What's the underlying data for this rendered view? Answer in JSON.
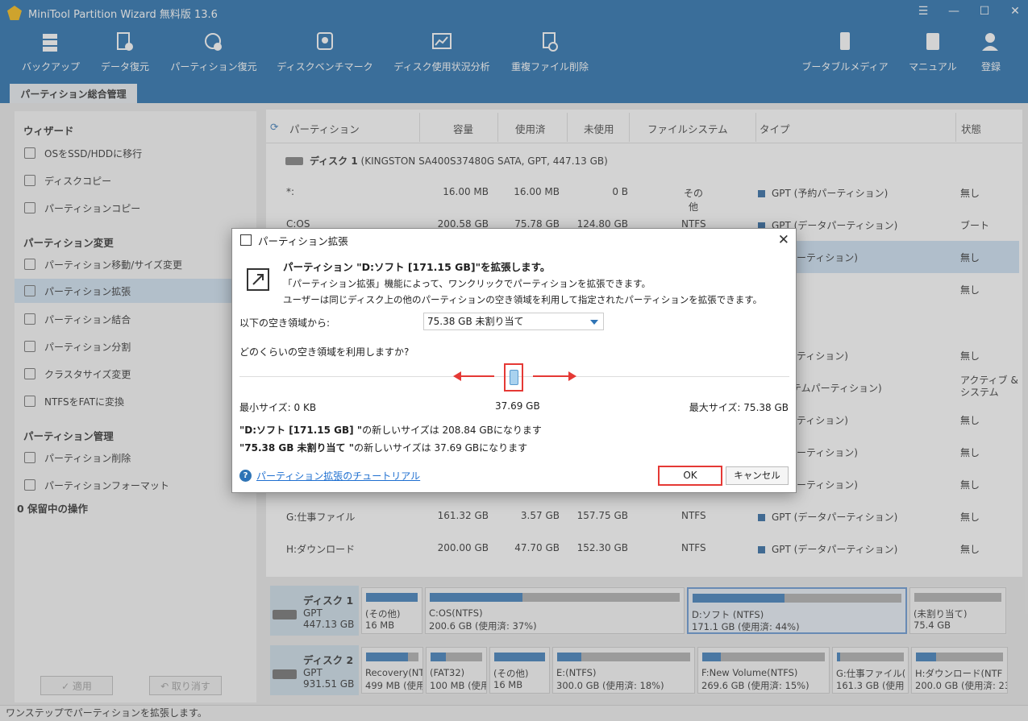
{
  "window": {
    "title": "MiniTool Partition Wizard 無料版 13.6"
  },
  "toolbar": {
    "items": [
      {
        "label": "バックアップ",
        "icon": "backup-icon"
      },
      {
        "label": "データ復元",
        "icon": "data-recovery-icon"
      },
      {
        "label": "パーティション復元",
        "icon": "partition-recovery-icon"
      },
      {
        "label": "ディスクベンチマーク",
        "icon": "disk-benchmark-icon"
      },
      {
        "label": "ディスク使用状況分析",
        "icon": "space-analyzer-icon"
      },
      {
        "label": "重複ファイル削除",
        "icon": "duplicate-file-icon"
      },
      {
        "label": "ブータブルメディア",
        "icon": "bootable-media-icon"
      },
      {
        "label": "マニュアル",
        "icon": "manual-icon"
      },
      {
        "label": "登録",
        "icon": "register-icon"
      }
    ]
  },
  "tab": {
    "label": "パーティション総合管理"
  },
  "sidebar": {
    "wizard_title": "ウィザード",
    "wizard_items": [
      "OSをSSD/HDDに移行",
      "ディスクコピー",
      "パーティションコピー"
    ],
    "change_title": "パーティション変更",
    "change_items": [
      "パーティション移動/サイズ変更",
      "パーティション拡張",
      "パーティション結合",
      "パーティション分割",
      "クラスタサイズ変更",
      "NTFSをFATに変換"
    ],
    "manage_title": "パーティション管理",
    "manage_items": [
      "パーティション削除",
      "パーティションフォーマット"
    ],
    "pending": "0 保留中の操作",
    "apply": "✓ 適用",
    "undo": "↶ 取り消す"
  },
  "table": {
    "headers": [
      "パーティション",
      "容量",
      "使用済",
      "未使用",
      "ファイルシステム",
      "タイプ",
      "状態"
    ],
    "disk1_header": "ディスク 1 (KINGSTON SA400S37480G SATA, GPT, 447.13 GB)",
    "disk1_name": "ディスク 1",
    "disk1_detail": "(KINGSTON SA400S37480G SATA, GPT, 447.13 GB)",
    "rows": [
      {
        "name": "*:",
        "cap": "16.00 MB",
        "used": "16.00 MB",
        "free": "0 B",
        "fs": "その他",
        "type": "GPT (予約パーティション)",
        "status": "無し"
      },
      {
        "name": "C:OS",
        "cap": "200.58 GB",
        "used": "75.78 GB",
        "free": "124.80 GB",
        "fs": "NTFS",
        "type": "GPT (データパーティション)",
        "status": "ブート"
      },
      {
        "name": "",
        "cap": "",
        "used": "",
        "free": "",
        "fs": "",
        "type": "データパーティション)",
        "status": "無し"
      },
      {
        "name": "",
        "cap": "",
        "used": "",
        "free": "",
        "fs": "",
        "type": "",
        "status": "無し"
      },
      {
        "name": "",
        "cap": "",
        "used": "",
        "free": "",
        "fs": "",
        "type": "復元パーティション)",
        "status": "無し"
      },
      {
        "name": "",
        "cap": "",
        "used": "",
        "free": "",
        "fs": "",
        "type": "EFIシステムパーティション)",
        "status": "アクティブ & システム"
      },
      {
        "name": "",
        "cap": "",
        "used": "",
        "free": "",
        "fs": "",
        "type": "予約パーティション)",
        "status": "無し"
      },
      {
        "name": "",
        "cap": "",
        "used": "",
        "free": "",
        "fs": "",
        "type": "データパーティション)",
        "status": "無し"
      },
      {
        "name": "",
        "cap": "",
        "used": "",
        "free": "",
        "fs": "",
        "type": "データパーティション)",
        "status": "無し"
      },
      {
        "name": "G:仕事ファイル",
        "cap": "161.32 GB",
        "used": "3.57 GB",
        "free": "157.75 GB",
        "fs": "NTFS",
        "type": "GPT (データパーティション)",
        "status": "無し"
      },
      {
        "name": "H:ダウンロード",
        "cap": "200.00 GB",
        "used": "47.70 GB",
        "free": "152.30 GB",
        "fs": "NTFS",
        "type": "GPT (データパーティション)",
        "status": "無し"
      }
    ]
  },
  "diskmap": {
    "disk1": {
      "name": "ディスク 1",
      "style": "GPT",
      "size": "447.13 GB",
      "parts": [
        {
          "l1": "(その他)",
          "l2": "16 MB",
          "used": 1.0
        },
        {
          "l1": "C:OS(NTFS)",
          "l2": "200.6 GB (使用済: 37%)",
          "used": 0.37
        },
        {
          "l1": "D:ソフト (NTFS)",
          "l2": "171.1 GB (使用済: 44%)",
          "used": 0.44
        },
        {
          "l1": "(未割り当て)",
          "l2": "75.4 GB",
          "used": 0.0
        }
      ]
    },
    "disk2": {
      "name": "ディスク 2",
      "style": "GPT",
      "size": "931.51 GB",
      "parts": [
        {
          "l1": "Recovery(NT",
          "l2": "499 MB (使用",
          "used": 0.8
        },
        {
          "l1": "(FAT32)",
          "l2": "100 MB (使用",
          "used": 0.3
        },
        {
          "l1": "(その他)",
          "l2": "16 MB",
          "used": 1.0
        },
        {
          "l1": "E:(NTFS)",
          "l2": "300.0 GB (使用済: 18%)",
          "used": 0.18
        },
        {
          "l1": "F:New Volume(NTFS)",
          "l2": "269.6 GB (使用済: 15%)",
          "used": 0.15
        },
        {
          "l1": "G:仕事ファイル(",
          "l2": "161.3 GB (使用",
          "used": 0.05
        },
        {
          "l1": "H:ダウンロード(NTF",
          "l2": "200.0 GB (使用済: 23'",
          "used": 0.23
        }
      ]
    }
  },
  "dialog": {
    "title": "パーティション拡張",
    "heading": "パーティション \"D:ソフト [171.15 GB]\"を拡張します。",
    "line1": "「パーティション拡張」機能によって、ワンクリックでパーティションを拡張できます。",
    "line2": "ユーザーは同じディスク上の他のパーティションの空き領域を利用して指定されたパーティションを拡張できます。",
    "from_label": "以下の空き領域から:",
    "from_value": "75.38 GB 未割り当て",
    "how_much": "どのくらいの空き領域を利用しますか?",
    "min": "最小サイズ: 0 KB",
    "current": "37.69 GB",
    "max": "最大サイズ: 75.38 GB",
    "slider_fraction": 0.5,
    "res1_bold": "\"D:ソフト [171.15 GB] \"",
    "res1_rest": "の新しいサイズは 208.84 GBになります",
    "res2_bold": "\"75.38 GB 未割り当て \"",
    "res2_rest": "の新しいサイズは 37.69 GBになります",
    "tutorial": "パーティション拡張のチュートリアル",
    "ok": "OK",
    "cancel": "キャンセル"
  },
  "status": "ワンステップでパーティションを拡張します。",
  "colors": {
    "brand": "#1565a8",
    "highlight": "#e53935",
    "used_bar": "#2f74b5"
  }
}
